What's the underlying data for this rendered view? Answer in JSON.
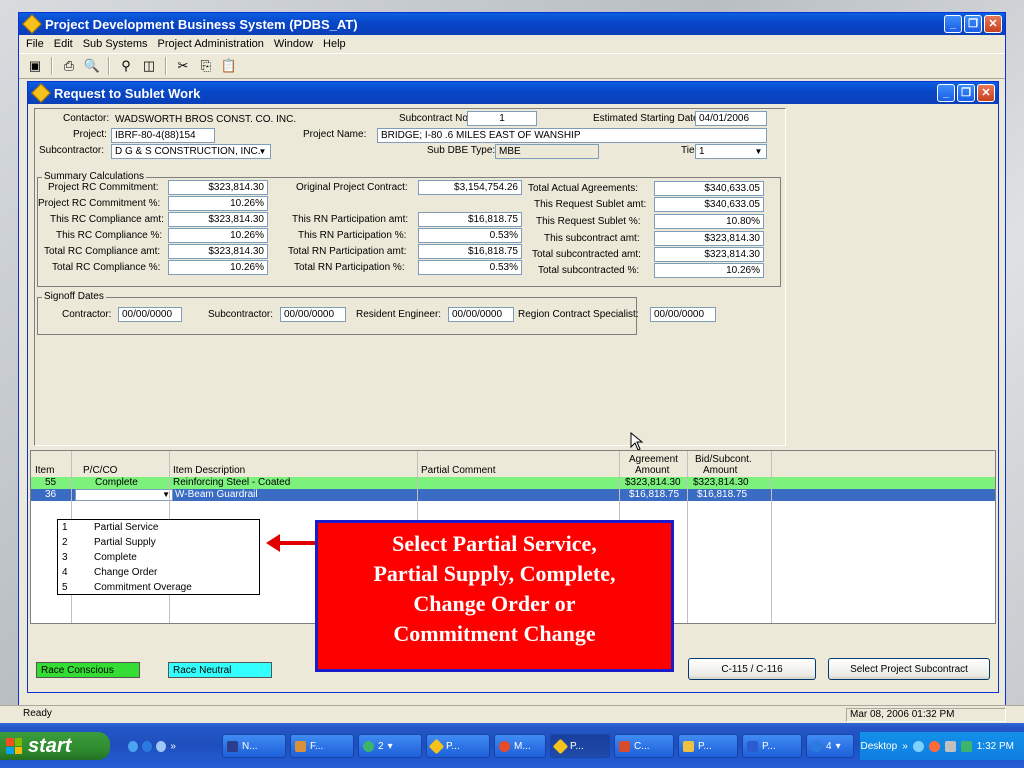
{
  "app": {
    "title": "Project Development Business System (PDBS_AT)",
    "menus": [
      "File",
      "Edit",
      "Sub Systems",
      "Project Administration",
      "Window",
      "Help"
    ],
    "window_buttons": [
      "_",
      "❐",
      "✕"
    ]
  },
  "toolbar": {
    "icons": [
      "save-icon",
      "print-icon",
      "print-preview-icon",
      "find-icon",
      "window-icon",
      "cut-icon",
      "copy-icon",
      "paste-icon"
    ],
    "glyphs": [
      "▣",
      "⎙",
      "🔍",
      "⚲",
      "◫",
      "✂",
      "⎘",
      "📋"
    ]
  },
  "dialog": {
    "title": "Request to Sublet Work",
    "contractor_label": "Contactor:",
    "contractor_value": "WADSWORTH BROS CONST. CO. INC.",
    "subcontract_no_label": "Subcontract No:",
    "subcontract_no_value": "1",
    "est_start_label": "Estimated Starting Date:",
    "est_start_value": "04/01/2006",
    "project_label": "Project:",
    "project_value": "IBRF-80-4(88)154",
    "project_name_label": "Project Name:",
    "project_name_value": "BRIDGE; I-80 .6 MILES EAST OF WANSHIP",
    "subcontractor_label": "Subcontractor:",
    "subcontractor_value": "D G & S CONSTRUCTION, INC.",
    "sub_dbe_label": "Sub DBE Type:",
    "sub_dbe_value": "MBE",
    "tier_label": "Tier:",
    "tier_value": "1"
  },
  "summary": {
    "title": "Summary Calculations",
    "col1": [
      {
        "label": "Project RC Commitment:",
        "value": "$323,814.30"
      },
      {
        "label": "Project RC Commitment %:",
        "value": "10.26%"
      },
      {
        "label": "This RC Compliance amt:",
        "value": "$323,814.30"
      },
      {
        "label": "This RC Compliance %:",
        "value": "10.26%"
      },
      {
        "label": "Total RC Compliance amt:",
        "value": "$323,814.30"
      },
      {
        "label": "Total RC Compliance %:",
        "value": "10.26%"
      }
    ],
    "col2": [
      {
        "label": "Original Project Contract:",
        "value": "$3,154,754.26"
      },
      {
        "label": "This RN Participation amt:",
        "value": "$16,818.75"
      },
      {
        "label": "This RN Participation %:",
        "value": "0.53%"
      },
      {
        "label": "Total RN Participation amt:",
        "value": "$16,818.75"
      },
      {
        "label": "Total RN Participation %:",
        "value": "0.53%"
      }
    ],
    "col3": [
      {
        "label": "Total Actual Agreements:",
        "value": "$340,633.05"
      },
      {
        "label": "This Request Sublet amt:",
        "value": "$340,633.05"
      },
      {
        "label": "This Request Sublet %:",
        "value": "10.80%"
      },
      {
        "label": "This subcontract amt:",
        "value": "$323,814.30"
      },
      {
        "label": "Total subcontracted amt:",
        "value": "$323,814.30"
      },
      {
        "label": "Total subcontracted %:",
        "value": "10.26%"
      }
    ]
  },
  "signoff": {
    "title": "Signoff Dates",
    "contractor_label": "Contractor:",
    "contractor_value": "00/00/0000",
    "subcontractor_label": "Subcontractor:",
    "subcontractor_value": "00/00/0000",
    "resident_label": "Resident Engineer:",
    "resident_value": "00/00/0000",
    "region_label": "Region Contract Specialist:",
    "region_value": "00/00/0000"
  },
  "grid": {
    "headers": {
      "item": "Item",
      "pcco": "P/C/CO",
      "desc": "Item Description",
      "comment": "Partial Comment",
      "agree1": "Agreement",
      "agree2": "Amount",
      "bid1": "Bid/Subcont.",
      "bid2": "Amount"
    },
    "rows": [
      {
        "item": "55",
        "pcco": "Complete",
        "desc": "Reinforcing Steel - Coated",
        "comment": "",
        "agreement": "$323,814.30",
        "bid": "$323,814.30"
      },
      {
        "item": "36",
        "pcco": "",
        "desc": "W-Beam Guardrail",
        "comment": "",
        "agreement": "$16,818.75",
        "bid": "$16,818.75"
      }
    ],
    "row_colors": [
      "#7cf27c",
      "#3a6cc4"
    ]
  },
  "dropdown": {
    "options": [
      {
        "num": "1",
        "label": "Partial Service"
      },
      {
        "num": "2",
        "label": "Partial Supply"
      },
      {
        "num": "3",
        "label": "Complete"
      },
      {
        "num": "4",
        "label": "Change Order"
      },
      {
        "num": "5",
        "label": "Commitment Overage"
      }
    ]
  },
  "callout": {
    "lines": [
      "Select Partial Service,",
      "Partial Supply, Complete,",
      "Change Order or",
      "Commitment Change"
    ],
    "bg_color": "#fe0000",
    "border_color": "#1b1bcc"
  },
  "legend": {
    "race_conscious": "Race Conscious",
    "race_conscious_color": "#33dd33",
    "race_neutral": "Race Neutral",
    "race_neutral_color": "#33ffff"
  },
  "buttons": {
    "c115": "C-115 / C-116",
    "select_sub": "Select Project Subcontract"
  },
  "status": {
    "text": "Ready",
    "datetime": "Mar 08, 2006 01:32 PM"
  },
  "taskbar": {
    "start": "start",
    "tasks": [
      "N...",
      "F...",
      "2",
      "P...",
      "M...",
      "P...",
      "C...",
      "P...",
      "P...",
      "4"
    ],
    "desktop": "Desktop",
    "clock": "1:32 PM"
  }
}
